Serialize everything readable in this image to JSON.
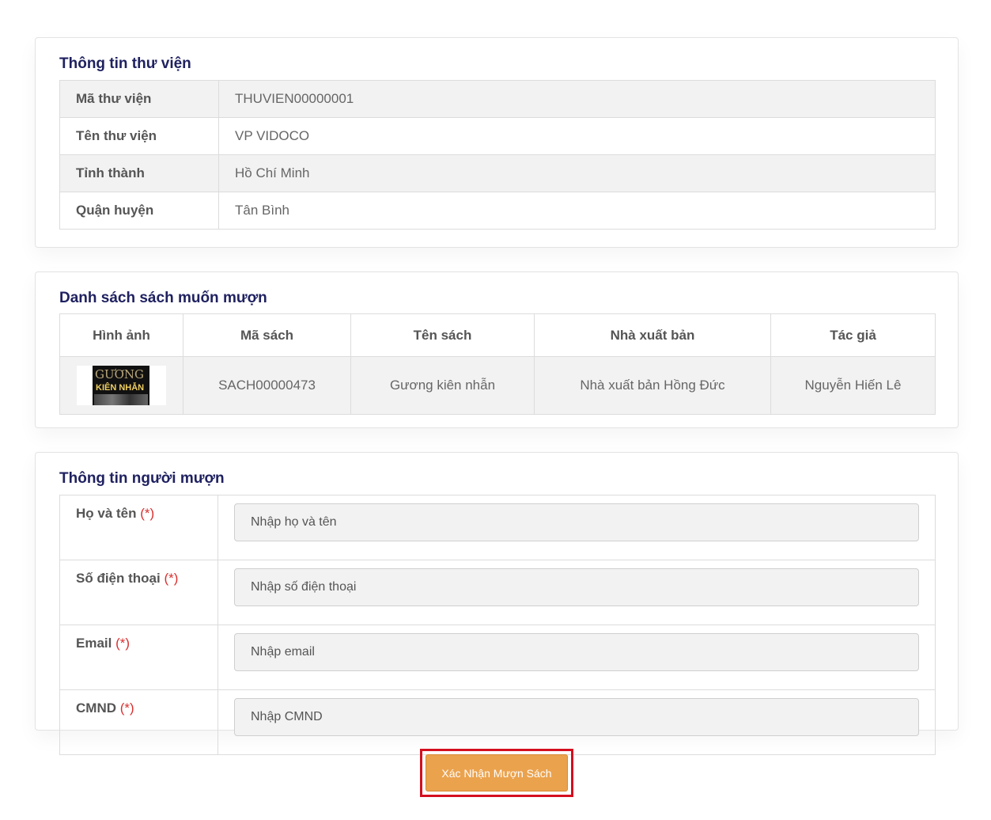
{
  "library_section": {
    "title": "Thông tin thư viện",
    "rows": [
      {
        "label": "Mã thư viện",
        "value": "THUVIEN00000001"
      },
      {
        "label": "Tên thư viện",
        "value": "VP VIDOCO"
      },
      {
        "label": "Tỉnh thành",
        "value": "Hồ Chí Minh"
      },
      {
        "label": "Quận huyện",
        "value": "Tân Bình"
      }
    ]
  },
  "books_section": {
    "title": "Danh sách sách muốn mượn",
    "headers": [
      "Hình ảnh",
      "Mã sách",
      "Tên sách",
      "Nhà xuất bản",
      "Tác giả"
    ],
    "rows": [
      {
        "cover": {
          "line1": "GƯƠNG",
          "line2": "KIÊN NHẪN"
        },
        "code": "SACH00000473",
        "name": "Gương kiên nhẫn",
        "publisher": "Nhà xuất bản Hồng Đức",
        "author": "Nguyễn Hiến Lê"
      }
    ]
  },
  "borrower_section": {
    "title": "Thông tin người mượn",
    "required_mark": "(*)",
    "fields": [
      {
        "label": "Họ và tên",
        "placeholder": "Nhập họ và tên",
        "value": ""
      },
      {
        "label": "Số điện thoại",
        "placeholder": "Nhập số điện thoại",
        "value": ""
      },
      {
        "label": "Email",
        "placeholder": "Nhập email",
        "value": ""
      },
      {
        "label": "CMND",
        "placeholder": "Nhập CMND",
        "value": ""
      }
    ]
  },
  "submit": {
    "label": "Xác Nhận Mượn Sách"
  },
  "colors": {
    "title": "#1f2160",
    "required": "#d9302f",
    "button": "#eba24d",
    "highlight_border": "#d40f1f"
  }
}
